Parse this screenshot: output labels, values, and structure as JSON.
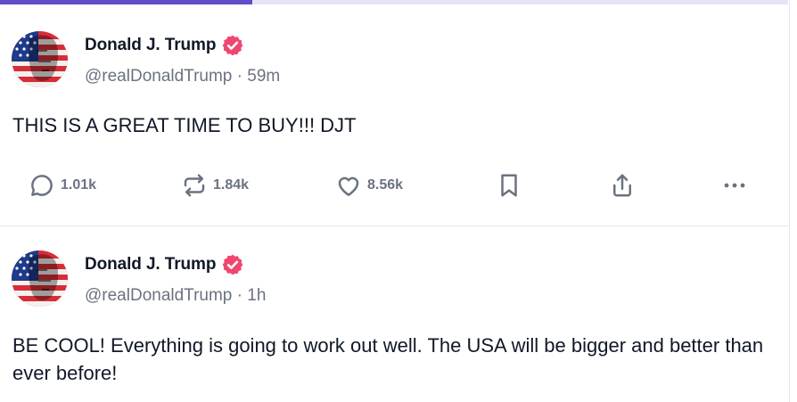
{
  "progress": {
    "fraction": 0.32,
    "fill_color": "#5f4ec8",
    "track_color": "#e6e4f5"
  },
  "colors": {
    "verified": "#ef476f",
    "muted": "#6b7280",
    "text": "#111827"
  },
  "posts": [
    {
      "avatar_icon": "flag-face-avatar",
      "display_name": "Donald J. Trump",
      "handle_line": "@realDonaldTrump · 59m",
      "text": "THIS IS A GREAT TIME TO BUY!!! DJT",
      "actions": {
        "reply_count": "1.01k",
        "retruth_count": "1.84k",
        "like_count": "8.56k"
      },
      "icons": [
        "reply-icon",
        "retruth-icon",
        "like-icon",
        "bookmark-icon",
        "share-icon",
        "more-icon"
      ]
    },
    {
      "avatar_icon": "flag-face-avatar",
      "display_name": "Donald J. Trump",
      "handle_line": "@realDonaldTrump · 1h",
      "text": "BE COOL! Everything is going to work out well. The USA will be bigger and better than ever before!"
    }
  ]
}
